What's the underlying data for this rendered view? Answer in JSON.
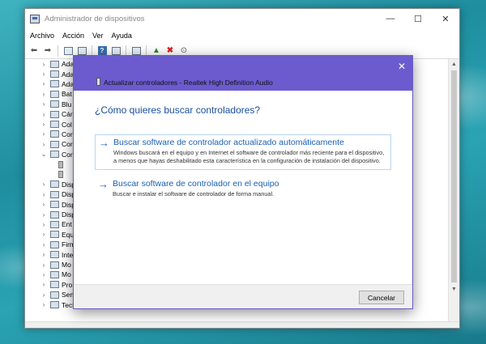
{
  "window": {
    "title": "Administrador de dispositivos",
    "controls": [
      "—",
      "☐",
      "✕"
    ]
  },
  "menu": [
    "Archivo",
    "Acción",
    "Ver",
    "Ayuda"
  ],
  "tree": {
    "items": [
      {
        "label": "Ada",
        "expanded": false
      },
      {
        "label": "Ada",
        "expanded": false
      },
      {
        "label": "Ada",
        "expanded": false
      },
      {
        "label": "Bat",
        "expanded": false
      },
      {
        "label": "Blu",
        "expanded": false
      },
      {
        "label": "Cár",
        "expanded": false
      },
      {
        "label": "Col",
        "expanded": false
      },
      {
        "label": "Cor",
        "expanded": false
      },
      {
        "label": "Cor",
        "expanded": false
      },
      {
        "label": "Cor",
        "expanded": true
      },
      {
        "label": "",
        "child": true
      },
      {
        "label": "",
        "child": true
      },
      {
        "label": "Disp",
        "expanded": false
      },
      {
        "label": "Disp",
        "expanded": false
      },
      {
        "label": "Disp",
        "expanded": false
      },
      {
        "label": "Disp",
        "expanded": false
      },
      {
        "label": "Ent",
        "expanded": false
      },
      {
        "label": "Equ",
        "expanded": false
      },
      {
        "label": "Firm",
        "expanded": false
      },
      {
        "label": "Inte",
        "expanded": false
      },
      {
        "label": "Mo",
        "expanded": false
      },
      {
        "label": "Mo",
        "expanded": false
      },
      {
        "label": "Pro",
        "expanded": false
      },
      {
        "label": "Sen",
        "expanded": false
      },
      {
        "label": "Teclados",
        "expanded": false
      }
    ]
  },
  "dialog": {
    "close_glyph": "✕",
    "title": "Actualizar controladores - Realtek High Definition Audio",
    "question": "¿Cómo quieres buscar controladores?",
    "option_arrow": "→",
    "option1": {
      "title": "Buscar software de controlador actualizado automáticamente",
      "desc": "Windows buscará en el equipo y en Internet el software de controlador más reciente para el dispositivo, a menos que hayas deshabilitado esta característica en la configuración de instalación del dispositivo."
    },
    "option2": {
      "title": "Buscar software de controlador en el equipo",
      "desc": "Buscar e instalar el software de controlador de forma manual."
    },
    "cancel_label": "Cancelar"
  }
}
